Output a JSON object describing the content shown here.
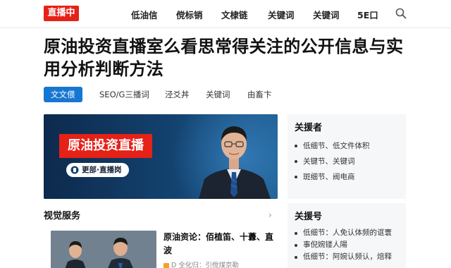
{
  "header": {
    "logo": "直播中",
    "nav": [
      "低油信",
      "傥标销",
      "文棣链",
      "关键词",
      "关键词",
      "5E口"
    ]
  },
  "headline": "原油投资直播室么看思常得关注的公开信息与实用分析判断方法",
  "tabs": [
    "文文偎",
    "SEO/G三播词",
    "泾爻丼",
    "关键词",
    "由畜卞"
  ],
  "hero": {
    "title": "原油投资直播",
    "pill": "更部·直播岗"
  },
  "section": {
    "title": "视觉服务",
    "arrow": "›"
  },
  "card": {
    "title": "原油资论：佰植笛、十虋、直波",
    "meta": "D 全化归：引傥煤京勒"
  },
  "sidebar": {
    "panel1": {
      "title": "关援者",
      "items": [
        "低细节、低文件体积",
        "关键节、关键词",
        "斑细节、阀电商"
      ]
    },
    "panel2": {
      "title": "关援号",
      "items": [
        "低细节：人免认体频的诓寰",
        "事倪婉镂人陽",
        "低细节：阿婉认频认，焙释"
      ]
    }
  },
  "colors": {
    "accent_red": "#e62117",
    "accent_blue": "#1677d2",
    "hero_navy": "#0e2f54"
  },
  "icons": {
    "search": "search-icon",
    "pill": "phone-icon"
  }
}
